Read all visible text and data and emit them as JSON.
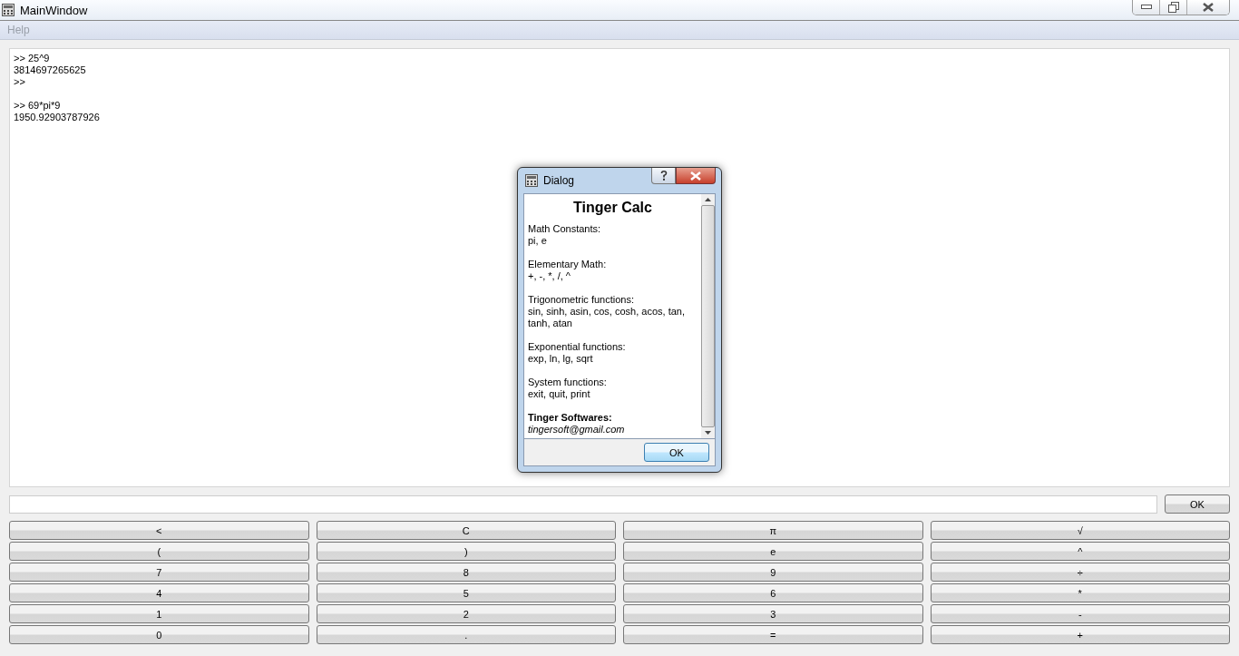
{
  "window": {
    "title": "MainWindow"
  },
  "menu": [
    "Help"
  ],
  "console": [
    {
      "lines": [
        ">> 25^9",
        "3814697265625",
        ">>"
      ]
    },
    {
      "lines": [
        ">> 69*pi*9",
        "1950.92903787926"
      ]
    }
  ],
  "submit_button": "OK",
  "keypad": [
    [
      "<",
      "C",
      "π",
      "√"
    ],
    [
      "(",
      ")",
      "e",
      "^"
    ],
    [
      "7",
      "8",
      "9",
      "÷"
    ],
    [
      "4",
      "5",
      "6",
      "*"
    ],
    [
      "1",
      "2",
      "3",
      "-"
    ],
    [
      "0",
      ".",
      "=",
      "+"
    ]
  ],
  "dialog": {
    "title": "Dialog",
    "heading": "Tinger Calc",
    "sections": [
      {
        "heading": "Math Constants:",
        "text": "pi, e"
      },
      {
        "heading": "Elementary Math:",
        "text": "+, -, *, /, ^"
      },
      {
        "heading": "Trigonometric functions:",
        "text": "sin, sinh, asin, cos, cosh, acos, tan, tanh, atan"
      },
      {
        "heading": "Exponential functions:",
        "text": "exp, ln, lg, sqrt"
      },
      {
        "heading": "System functions:",
        "text": "exit, quit, print"
      }
    ],
    "author": "Tinger Softwares:",
    "email": "tingersoft@gmail.com",
    "button": "OK"
  }
}
